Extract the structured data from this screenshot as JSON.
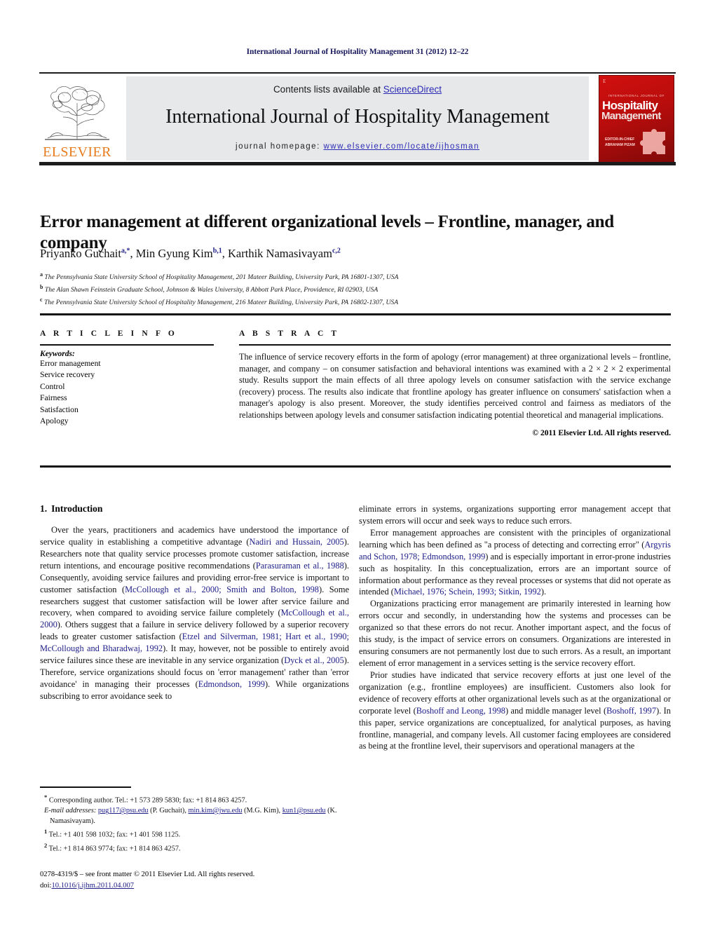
{
  "running_head": "International Journal of Hospitality Management 31 (2012) 12–22",
  "masthead": {
    "contents_prefix": "Contents lists available at ",
    "sciencedirect": "ScienceDirect",
    "journal_title": "International Journal of Hospitality Management",
    "homepage_label": "journal homepage: ",
    "homepage_url": "www.elsevier.com/locate/ijhosman",
    "publisher": "ELSEVIER",
    "accent_orange": "#E87B1E",
    "link_blue": "#2b2bb5",
    "band_gray": "#e7e8ea",
    "cover": {
      "elsevier_mark": "E",
      "small_top": "INTERNATIONAL JOURNAL OF",
      "word1": "Hospitality",
      "word2": "Management",
      "bottom_line1": "EDITOR-IN-CHIEF",
      "bottom_line2": "ABRAHAM PIZAM",
      "red": "#c81110"
    }
  },
  "article": {
    "title": "Error management at different organizational levels – Frontline, manager, and company",
    "authors": [
      {
        "name": "Priyanko Guchait",
        "sup": "a,*"
      },
      {
        "name": "Min Gyung Kim",
        "sup": "b,1"
      },
      {
        "name": "Karthik Namasivayam",
        "sup": "c,2"
      }
    ],
    "affiliations": [
      {
        "mark": "a",
        "text": "The Pennsylvania State University School of Hospitality Management, 201 Mateer Building, University Park, PA 16801-1307, USA"
      },
      {
        "mark": "b",
        "text": "The Alan Shawn Feinstein Graduate School, Johnson & Wales University, 8 Abbott Park Place, Providence, RI 02903, USA"
      },
      {
        "mark": "c",
        "text": "The Pennsylvania State University School of Hospitality Management, 216 Mateer Building, University Park, PA 16802-1307, USA"
      }
    ]
  },
  "article_info": {
    "heading": "A R T I C L E   I N F O",
    "keywords_label": "Keywords:",
    "keywords": [
      "Error management",
      "Service recovery",
      "Control",
      "Fairness",
      "Satisfaction",
      "Apology"
    ]
  },
  "abstract": {
    "heading": "A B S T R A C T",
    "text": "The influence of service recovery efforts in the form of apology (error management) at three organizational levels – frontline, manager, and company – on consumer satisfaction and behavioral intentions was examined with a 2 × 2 × 2 experimental study. Results support the main effects of all three apology levels on consumer satisfaction with the service exchange (recovery) process. The results also indicate that frontline apology has greater influence on consumers' satisfaction when a manager's apology is also present. Moreover, the study identifies perceived control and fairness as mediators of the relationships between apology levels and consumer satisfaction indicating potential theoretical and managerial implications.",
    "copyright": "© 2011 Elsevier Ltd. All rights reserved."
  },
  "body": {
    "section_number": "1.",
    "section_title": "Introduction",
    "left_paragraphs": [
      {
        "runs": [
          {
            "t": "Over the years, practitioners and academics have understood the importance of service quality in establishing a competitive advantage (",
            "c": false
          },
          {
            "t": "Nadiri and Hussain, 2005",
            "c": true
          },
          {
            "t": "). Researchers note that quality service processes promote customer satisfaction, increase return intentions, and encourage positive recommendations (",
            "c": false
          },
          {
            "t": "Parasuraman et al., 1988",
            "c": true
          },
          {
            "t": "). Consequently, avoiding service failures and providing error-free service is important to customer satisfaction (",
            "c": false
          },
          {
            "t": "McCollough et al., 2000; Smith and Bolton, 1998",
            "c": true
          },
          {
            "t": "). Some researchers suggest that customer satisfaction will be lower after service failure and recovery, when compared to avoiding service failure completely (",
            "c": false
          },
          {
            "t": "McCollough et al., 2000",
            "c": true
          },
          {
            "t": "). Others suggest that a failure in service delivery followed by a superior recovery leads to greater customer satisfaction (",
            "c": false
          },
          {
            "t": "Etzel and Silverman, 1981; Hart et al., 1990; McCollough and Bharadwaj, 1992",
            "c": true
          },
          {
            "t": "). It may, however, not be possible to entirely avoid service failures since these are inevitable in any service organization (",
            "c": false
          },
          {
            "t": "Dyck et al., 2005",
            "c": true
          },
          {
            "t": "). Therefore, service organizations should focus on 'error management' rather than 'error avoidance' in managing their processes (",
            "c": false
          },
          {
            "t": "Edmondson, 1999",
            "c": true
          },
          {
            "t": "). While organizations subscribing to error avoidance seek to",
            "c": false
          }
        ]
      }
    ],
    "right_paragraphs": [
      {
        "indent": false,
        "runs": [
          {
            "t": "eliminate errors in systems, organizations supporting error management accept that system errors will occur and seek ways to reduce such errors.",
            "c": false
          }
        ]
      },
      {
        "indent": true,
        "runs": [
          {
            "t": "Error management approaches are consistent with the principles of organizational learning which has been defined as \"a process of detecting and correcting error\" (",
            "c": false
          },
          {
            "t": "Argyris and Schon, 1978; Edmondson, 1999",
            "c": true
          },
          {
            "t": ") and is especially important in error-prone industries such as hospitality. In this conceptualization, errors are an important source of information about performance as they reveal processes or systems that did not operate as intended (",
            "c": false
          },
          {
            "t": "Michael, 1976; Schein, 1993; Sitkin, 1992",
            "c": true
          },
          {
            "t": ").",
            "c": false
          }
        ]
      },
      {
        "indent": true,
        "runs": [
          {
            "t": "Organizations practicing error management are primarily interested in learning how errors occur and secondly, in understanding how the systems and processes can be organized so that these errors do not recur. Another important aspect, and the focus of this study, is the impact of service errors on consumers. Organizations are interested in ensuring consumers are not permanently lost due to such errors. As a result, an important element of error management in a services setting is the service recovery effort.",
            "c": false
          }
        ]
      },
      {
        "indent": true,
        "runs": [
          {
            "t": "Prior studies have indicated that service recovery efforts at just one level of the organization (e.g., frontline employees) are insufficient. Customers also look for evidence of recovery efforts at other organizational levels such as at the organizational or corporate level (",
            "c": false
          },
          {
            "t": "Boshoff and Leong, 1998",
            "c": true
          },
          {
            "t": ") and middle manager level (",
            "c": false
          },
          {
            "t": "Boshoff, 1997",
            "c": true
          },
          {
            "t": "). In this paper, service organizations are conceptualized, for analytical purposes, as having frontline, managerial, and company levels. All customer facing employees are considered as being at the frontline level, their supervisors and operational managers at the",
            "c": false
          }
        ]
      }
    ]
  },
  "footnotes": {
    "corresponding": {
      "mark": "*",
      "text": "Corresponding author. Tel.: +1 573 289 5830; fax: +1 814 863 4257."
    },
    "email_label": "E-mail addresses:",
    "emails": [
      {
        "addr": "pug117@psu.edu",
        "owner": "(P. Guchait),"
      },
      {
        "addr": "min.kim@jwu.edu",
        "owner": "(M.G. Kim),"
      },
      {
        "addr": "kun1@psu.edu",
        "owner": "(K. Namasivayam)."
      }
    ],
    "numbered": [
      {
        "mark": "1",
        "text": "Tel.: +1 401 598 1032; fax: +1 401 598 1125."
      },
      {
        "mark": "2",
        "text": "Tel.: +1 814 863 9774; fax: +1 814 863 4257."
      }
    ]
  },
  "imprint": {
    "issn_line": "0278-4319/$ – see front matter © 2011 Elsevier Ltd. All rights reserved.",
    "doi_prefix": "doi:",
    "doi": "10.1016/j.ijhm.2011.04.007"
  }
}
